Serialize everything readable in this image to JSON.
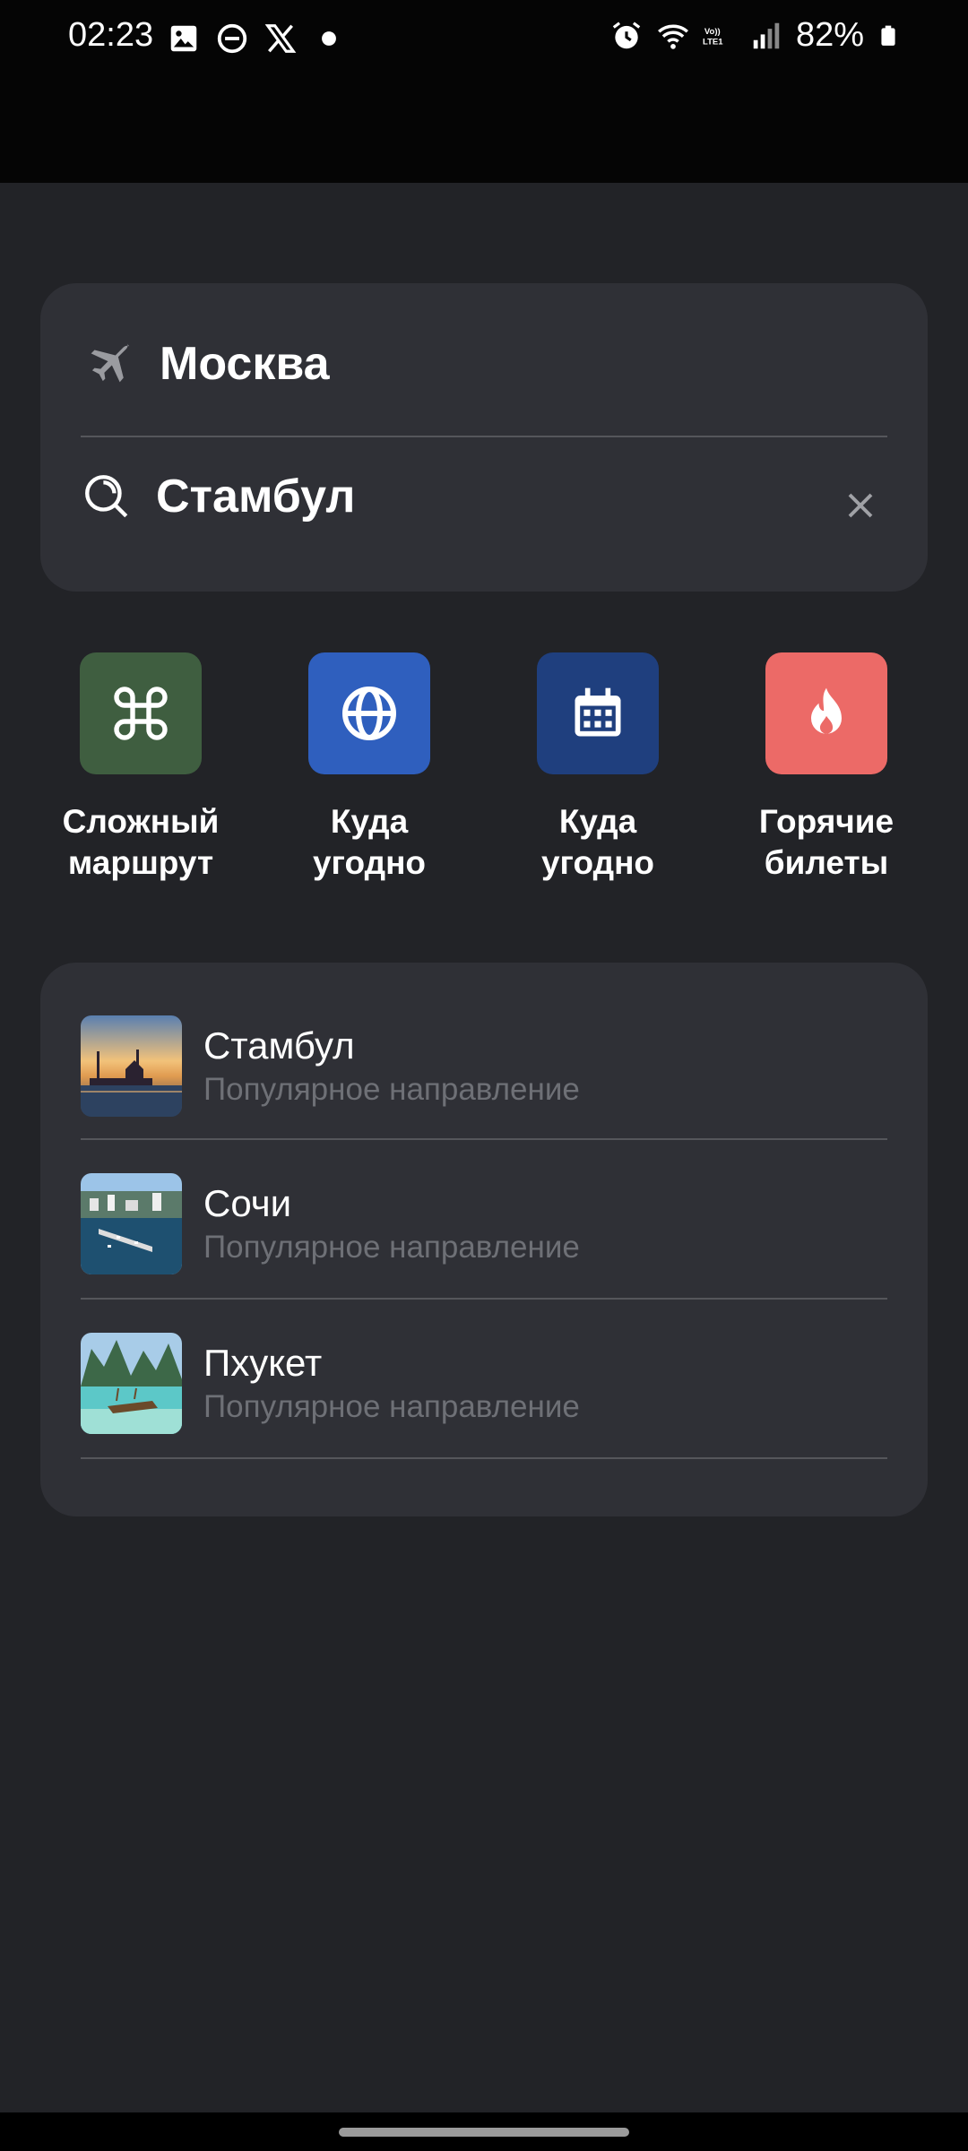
{
  "status_bar": {
    "time": "02:23",
    "battery": "82%",
    "network": "LTE1",
    "volte": "Vo))"
  },
  "search": {
    "from_value": "Москва",
    "to_value": "Стамбул"
  },
  "quick_actions": [
    {
      "label_line1": "Сложный",
      "label_line2": "маршрут",
      "icon": "command-icon",
      "color": "#3f5e40"
    },
    {
      "label_line1": "Куда",
      "label_line2": "угодно",
      "icon": "globe-icon",
      "color": "#2f5fbe"
    },
    {
      "label_line1": "Куда",
      "label_line2": "угодно",
      "icon": "calendar-icon",
      "color": "#1f3f7e"
    },
    {
      "label_line1": "Горячие",
      "label_line2": "билеты",
      "icon": "flame-icon",
      "color": "#ec6a67"
    }
  ],
  "suggestions": [
    {
      "title": "Стамбул",
      "subtitle": "Популярное направление"
    },
    {
      "title": "Сочи",
      "subtitle": "Популярное направление"
    },
    {
      "title": "Пхукет",
      "subtitle": "Популярное направление"
    }
  ],
  "colors": {
    "background": "#222327",
    "card": "#2f3036",
    "status_bar": "#050505"
  }
}
